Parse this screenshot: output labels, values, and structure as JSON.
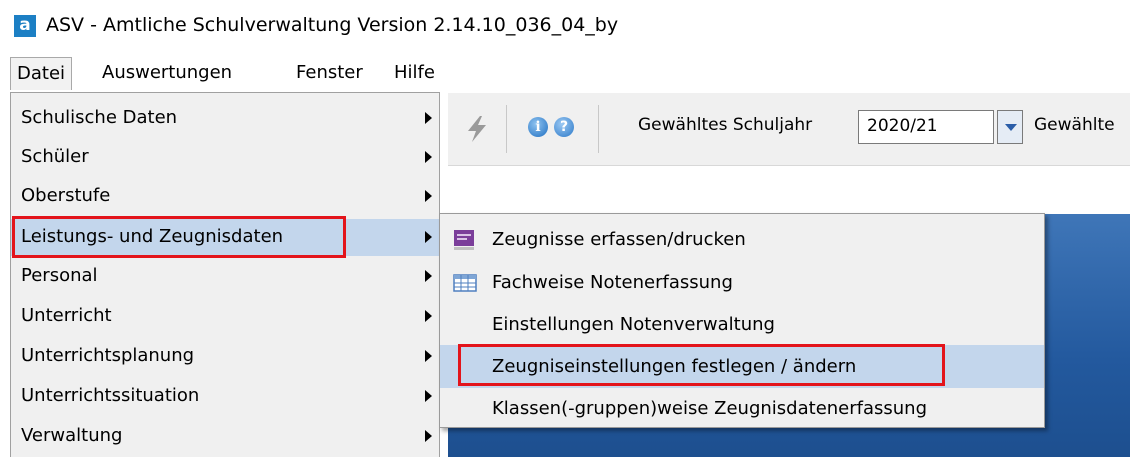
{
  "window": {
    "icon_letter": "a",
    "title": "ASV - Amtliche Schulverwaltung Version 2.14.10_036_04_by"
  },
  "menubar": {
    "items": [
      {
        "label": "Datei"
      },
      {
        "label": "Auswertungen"
      },
      {
        "label": "Fenster"
      },
      {
        "label": "Hilfe"
      }
    ]
  },
  "toolbar": {
    "school_year_label": "Gewähltes Schuljahr",
    "school_year_value": "2020/21",
    "truncated_label": "Gewählte"
  },
  "datei_menu": {
    "items": [
      {
        "label": "Schulische Daten"
      },
      {
        "label": "Schüler"
      },
      {
        "label": "Oberstufe"
      },
      {
        "label": "Leistungs- und Zeugnisdaten"
      },
      {
        "label": "Personal"
      },
      {
        "label": "Unterricht"
      },
      {
        "label": "Unterrichtsplanung"
      },
      {
        "label": "Unterrichtssituation"
      },
      {
        "label": "Verwaltung"
      }
    ]
  },
  "submenu": {
    "items": [
      {
        "label": "Zeugnisse erfassen/drucken",
        "icon": "certificate-icon"
      },
      {
        "label": "Fachweise Notenerfassung",
        "icon": "table-icon"
      },
      {
        "label": "Einstellungen Notenverwaltung"
      },
      {
        "label": "Zeugniseinstellungen festlegen / ändern"
      },
      {
        "label": "Klassen(-gruppen)weise Zeugnisdatenerfassung"
      }
    ]
  },
  "colors": {
    "highlight_box": "#e3141b",
    "hover": "#c3d6ec",
    "menu_background": "#f0f0f0",
    "panel_blue": "#23599e"
  }
}
